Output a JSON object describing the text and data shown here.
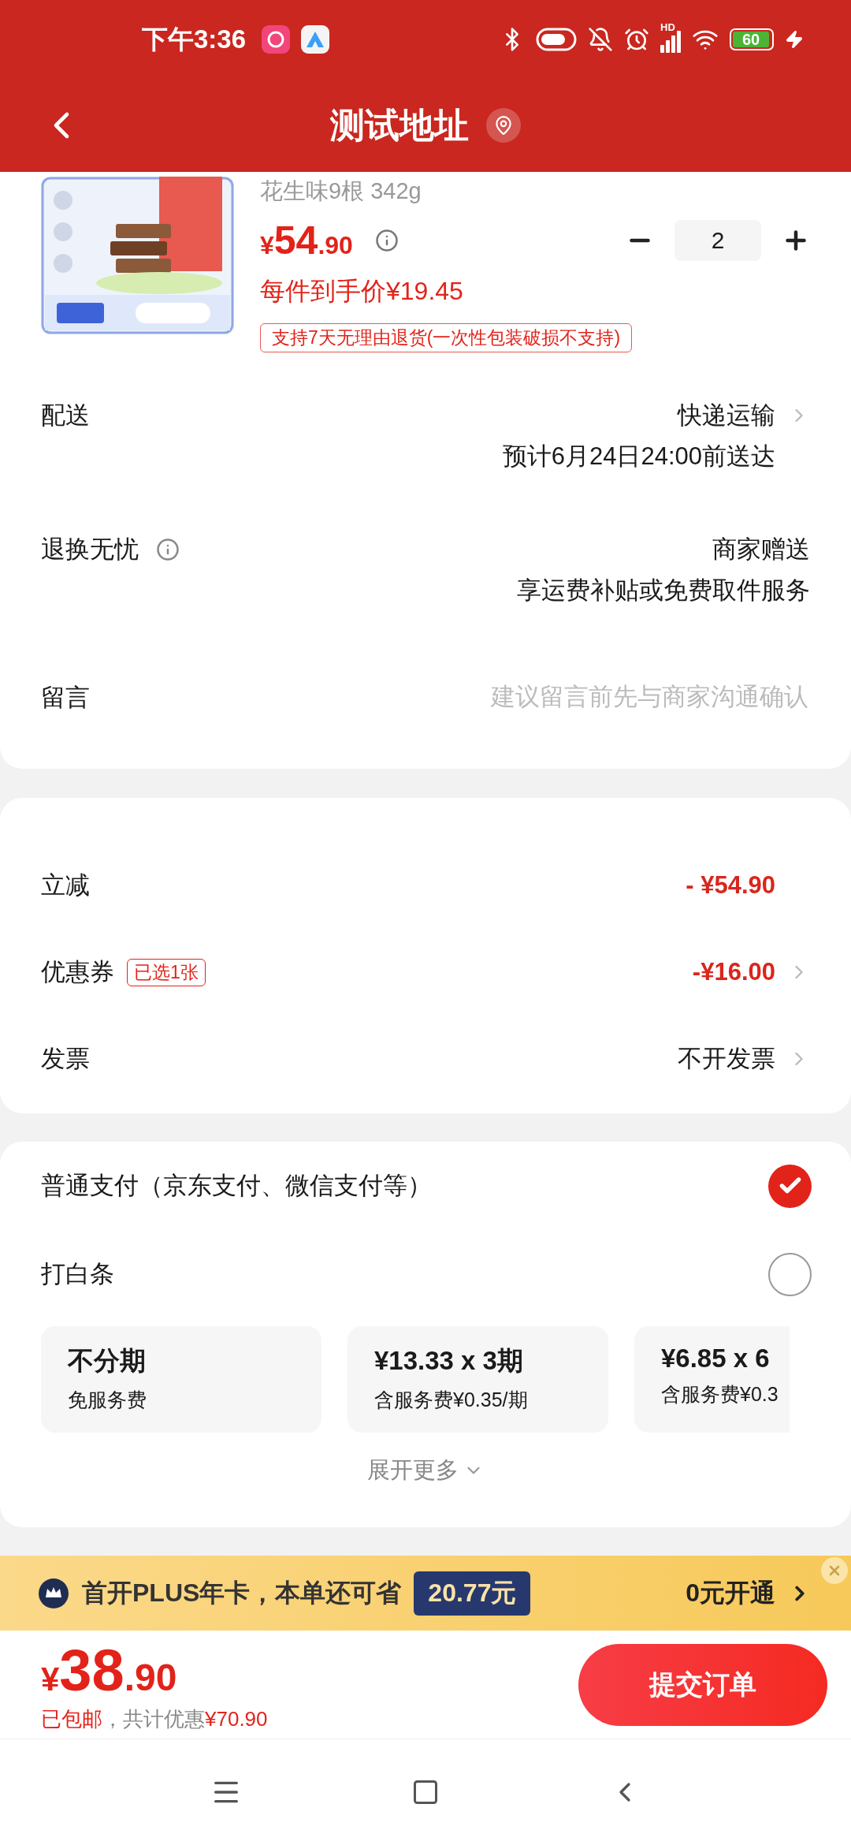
{
  "status_bar": {
    "time": "下午3:36",
    "signal_label": "HD",
    "battery": "60"
  },
  "header": {
    "title": "测试地址"
  },
  "product": {
    "title": "花生味9根 342g",
    "currency": "¥",
    "price_int": "54",
    "price_dec": ".90",
    "quantity": "2",
    "unit_price": "每件到手价¥19.45",
    "return_tag": "支持7天无理由退货(一次性包装破损不支持)"
  },
  "order_rows": [
    {
      "kind": "value",
      "label": "配送",
      "info": false,
      "chevron": true,
      "values": [
        "快递运输",
        "预计6月24日24:00前送达"
      ]
    },
    {
      "kind": "value",
      "label": "退换无忧",
      "info": true,
      "chevron": false,
      "values": [
        "商家赠送",
        "享运费补贴或免费取件服务"
      ]
    },
    {
      "kind": "input",
      "label": "留言",
      "placeholder": "建议留言前先与商家沟通确认"
    }
  ],
  "discount_rows": [
    {
      "kind": "discount",
      "label": "立减",
      "value": "- ¥54.90",
      "chevron": false
    },
    {
      "kind": "discount",
      "label": "优惠券",
      "badge": "已选1张",
      "value": "-¥16.00",
      "chevron": true
    },
    {
      "kind": "plain",
      "label": "发票",
      "value": "不开发票",
      "chevron": true
    }
  ],
  "payment": {
    "options": [
      {
        "label": "普通支付（京东支付、微信支付等）",
        "selected": true
      },
      {
        "label": "打白条",
        "selected": false
      }
    ],
    "installments": [
      {
        "title": "不分期",
        "sub": "免服务费",
        "selected": false
      },
      {
        "title": "¥13.33 x 3期",
        "sub": "含服务费¥0.35/期",
        "selected": false
      },
      {
        "title": "¥6.85 x 6",
        "sub": "含服务费¥0.3",
        "selected": false
      }
    ],
    "expand": "展开更多"
  },
  "plus_banner": {
    "text": "首开PLUS年卡，本单还可省",
    "amount": "20.77元",
    "action": "0元开通"
  },
  "footer": {
    "currency": "¥",
    "price_int": "38",
    "price_dec": ".90",
    "shipping": "已包邮",
    "saving_label": "，共计优惠",
    "saving": "¥70.90",
    "submit": "提交订单"
  }
}
